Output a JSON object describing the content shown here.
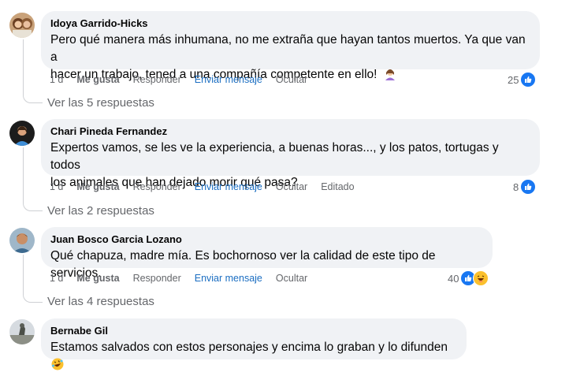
{
  "comments": [
    {
      "author": "Idoya Garrido-Hicks",
      "line1": "Pero qué manera más inhumana, no me extraña que hayan tantos muertos. Ya que van a",
      "line2": "hacer un trabajo, tened a una compañía competente en ello!",
      "time": "1 d",
      "like": "Me gusta",
      "reply": "Responder",
      "message": "Enviar mensaje",
      "hide": "Ocultar",
      "reaction_count": "25",
      "view_replies": "Ver las 5 respuestas"
    },
    {
      "author": "Chari Pineda Fernandez",
      "line1": "Expertos vamos, se les ve la experiencia, a buenas horas..., y los patos, tortugas y todos",
      "line2": "los animales que han dejado morir qué pasa?",
      "time": "1 d",
      "like": "Me gusta",
      "reply": "Responder",
      "message": "Enviar mensaje",
      "hide": "Ocultar",
      "edited": "Editado",
      "reaction_count": "8",
      "view_replies": "Ver las 2 respuestas"
    },
    {
      "author": "Juan Bosco Garcia Lozano",
      "line1": "Qué chapuza, madre mía. Es bochornoso ver la calidad de este tipo de servicios.",
      "time": "1 d",
      "like": "Me gusta",
      "reply": "Responder",
      "message": "Enviar mensaje",
      "hide": "Ocultar",
      "reaction_count": "40",
      "view_replies": "Ver las 4 respuestas"
    },
    {
      "author": "Bernabe Gil",
      "line1": "Estamos salvados con estos personajes y encima lo graban y lo difunden"
    }
  ],
  "icons": {
    "like": "thumbs-up-icon",
    "haha": "laughing-face-icon",
    "woman_shrugging": "woman-emoji-icon",
    "rofl": "rolling-laughing-emoji-icon"
  },
  "colors": {
    "bubble": "#f0f2f5",
    "like_blue": "#1877f2",
    "send_message_blue": "#1b6ec2",
    "meta_gray": "#65676b"
  }
}
